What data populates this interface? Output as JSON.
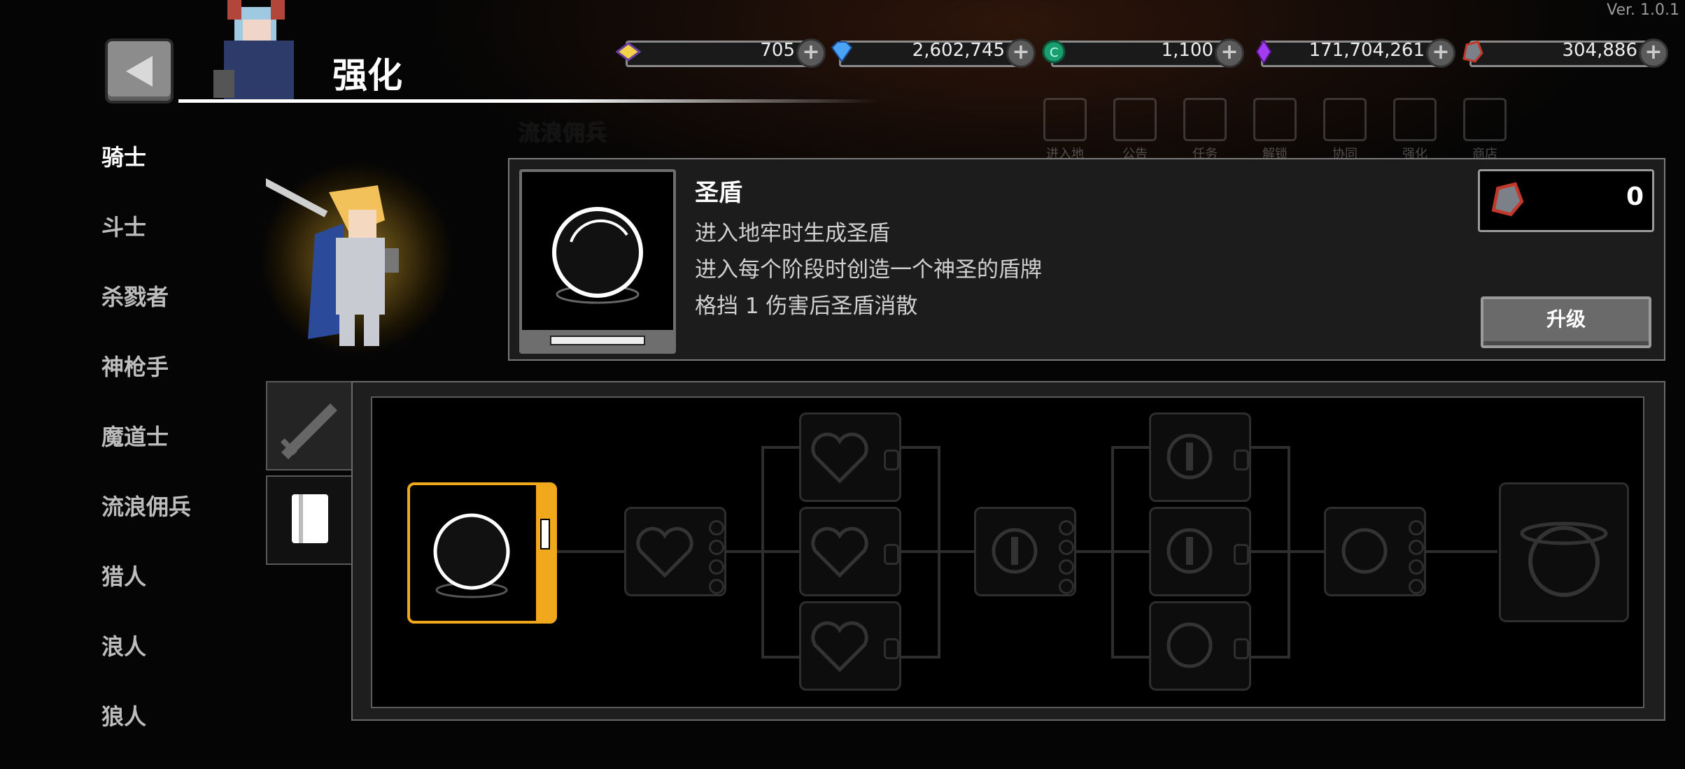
{
  "version": "Ver. 1.0.1",
  "header": {
    "title": "强化",
    "section_label": "流浪佣兵"
  },
  "currencies": [
    {
      "icon": "ticket-icon",
      "value": "705"
    },
    {
      "icon": "diamond-icon",
      "value": "2,602,745"
    },
    {
      "icon": "green-coin-icon",
      "value": "1,100"
    },
    {
      "icon": "purple-crystal-icon",
      "value": "171,704,261"
    },
    {
      "icon": "ore-icon",
      "value": "304,886"
    }
  ],
  "top_nav": [
    "进入地牢",
    "公告",
    "任务",
    "解锁",
    "协同",
    "强化",
    "商店"
  ],
  "classes": [
    "骑士",
    "斗士",
    "杀戮者",
    "神枪手",
    "魔道士",
    "流浪佣兵",
    "猎人",
    "浪人",
    "狼人"
  ],
  "skill": {
    "name": "圣盾",
    "lines": [
      "进入地牢时生成圣盾",
      "进入每个阶段时创造一个神圣的盾牌",
      "格挡 1 伤害后圣盾消散"
    ],
    "cost": "0",
    "upgrade_label": "升级"
  },
  "colors": {
    "accent": "#f2a81c",
    "panel": "#1c1c1c"
  }
}
